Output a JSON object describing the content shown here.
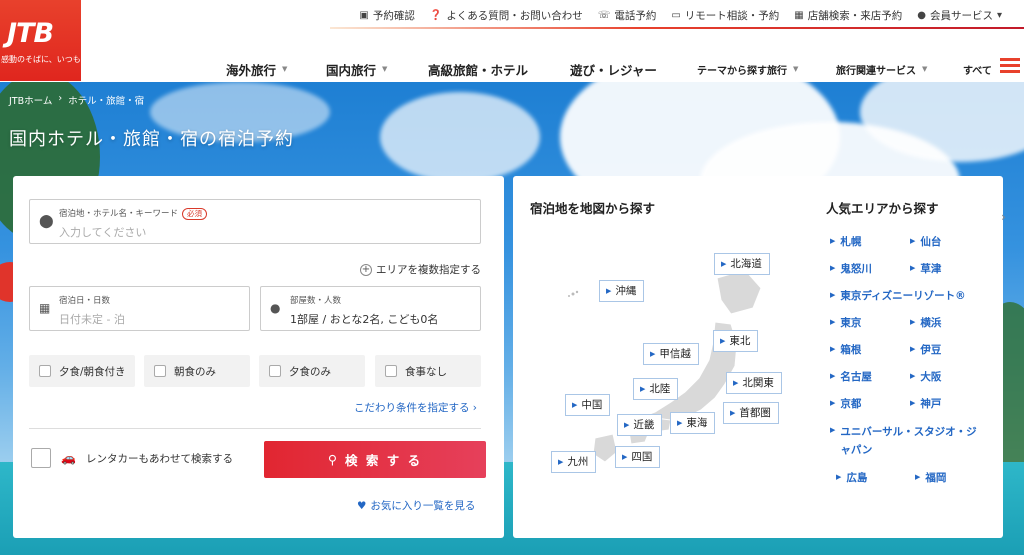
{
  "header": {
    "logo_text": "JTB",
    "logo_tagline": "感動のそばに、いつも。",
    "util_links": [
      {
        "icon": "calendar-check-icon",
        "glyph": "▣",
        "label": "予約確認"
      },
      {
        "icon": "help-circle-icon",
        "glyph": "❓",
        "label": "よくある質問・お問い合わせ"
      },
      {
        "icon": "phone-icon",
        "glyph": "☏",
        "label": "電話予約"
      },
      {
        "icon": "monitor-icon",
        "glyph": "▭",
        "label": "リモート相談・予約"
      },
      {
        "icon": "building-icon",
        "glyph": "▦",
        "label": "店舗検索・来店予約"
      },
      {
        "icon": "user-icon",
        "glyph": "●",
        "label": "会員サービス"
      }
    ],
    "nav": {
      "overseas": "海外旅行",
      "domestic": "国内旅行",
      "luxury": "高級旅館・ホテル",
      "leisure": "遊び・レジャー",
      "theme": "テーマから探す旅行",
      "services": "旅行関連サービス",
      "all": "すべて"
    }
  },
  "breadcrumb": {
    "home": "JTBホーム",
    "sep": "›",
    "current": "ホテル・旅館・宿"
  },
  "page_title": "国内ホテル・旅館・宿の宿泊予約",
  "search": {
    "destination": {
      "label": "宿泊地・ホテル名・キーワード",
      "required": "必須",
      "placeholder": "入力してください"
    },
    "multi_area": "エリアを複数指定する",
    "dates": {
      "label": "宿泊日・日数",
      "placeholder": "日付未定 - 泊"
    },
    "rooms": {
      "label": "部屋数・人数",
      "value": "1部屋 / おとな2名, こども0名"
    },
    "meals": [
      "夕食/朝食付き",
      "朝食のみ",
      "夕食のみ",
      "食事なし"
    ],
    "conditions_link": "こだわり条件を指定する ›",
    "rentacar_label": "レンタカーもあわせて検索する",
    "search_button": "検 索 す る",
    "favorites_link": "お気に入り一覧を見る"
  },
  "map": {
    "title": "宿泊地を地図から探す",
    "regions": {
      "hokkaido": "北海道",
      "okinawa": "沖縄",
      "tohoku": "東北",
      "koshinetsu": "甲信越",
      "hokuriku": "北陸",
      "kitakanto": "北関東",
      "chugoku": "中国",
      "shutoken": "首都圏",
      "kinki": "近畿",
      "tokai": "東海",
      "kyushu": "九州",
      "shikoku": "四国"
    }
  },
  "popular": {
    "title": "人気エリアから探す",
    "areas": {
      "sapporo": "札幌",
      "sendai": "仙台",
      "kinugawa": "鬼怒川",
      "kusatsu": "草津",
      "disney": "東京ディズニーリゾート®",
      "tokyo": "東京",
      "yokohama": "横浜",
      "hakone": "箱根",
      "izu": "伊豆",
      "nagoya": "名古屋",
      "osaka": "大阪",
      "kyoto": "京都",
      "kobe": "神戸",
      "usj": "ユニバーサル・スタジオ・ジャパン",
      "hiroshima": "広島",
      "fukuoka": "福岡"
    }
  },
  "colors": {
    "brand_red": "#e8412c",
    "link_blue": "#2367c4",
    "button_red": "#e12631"
  }
}
